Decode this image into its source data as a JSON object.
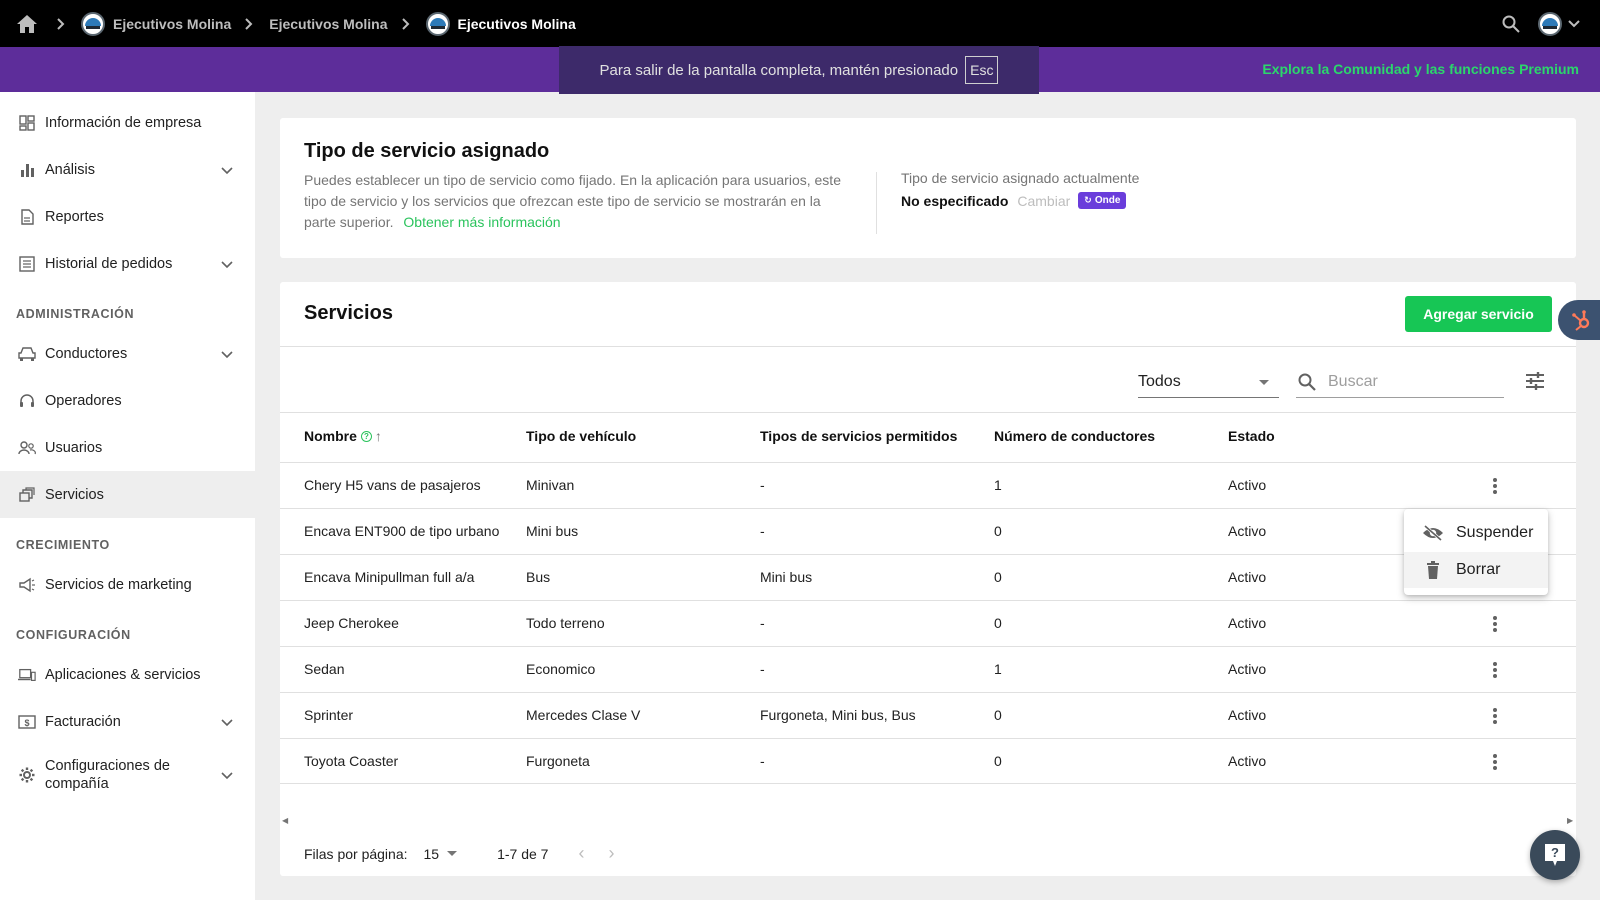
{
  "topbar": {
    "breadcrumbs": [
      {
        "label": "Ejecutivos Molina"
      },
      {
        "label": "Ejecutivos Molina"
      },
      {
        "label": "Ejecutivos Molina"
      }
    ]
  },
  "banner": {
    "fullscreen_message": "Para salir de la pantalla completa, mantén presionado",
    "esc_key": "Esc",
    "premium_link": "Explora la Comunidad y las funciones Premium"
  },
  "sidebar": {
    "items": [
      {
        "label": "Información de empresa",
        "icon": "dashboard-icon"
      },
      {
        "label": "Análisis",
        "icon": "bar-chart-icon",
        "expandable": true
      },
      {
        "label": "Reportes",
        "icon": "report-icon"
      },
      {
        "label": "Historial de pedidos",
        "icon": "list-icon",
        "expandable": true
      },
      {
        "label": "Conductores",
        "icon": "car-icon",
        "expandable": true
      },
      {
        "label": "Operadores",
        "icon": "headset-icon"
      },
      {
        "label": "Usuarios",
        "icon": "users-icon"
      },
      {
        "label": "Servicios",
        "icon": "services-icon",
        "active": true
      },
      {
        "label": "Servicios de marketing",
        "icon": "megaphone-icon"
      },
      {
        "label": "Aplicaciones & servicios",
        "icon": "devices-icon"
      },
      {
        "label": "Facturación",
        "icon": "billing-icon",
        "expandable": true
      },
      {
        "label": "Configuraciones de compañía",
        "icon": "gear-icon",
        "expandable": true
      }
    ],
    "sections": {
      "admin": "ADMINISTRACIÓN",
      "growth": "CRECIMIENTO",
      "config": "CONFIGURACIÓN"
    }
  },
  "assigned_card": {
    "title": "Tipo de servicio asignado",
    "description": "Puedes establecer un tipo de servicio como fijado. En la aplicación para usuarios, este tipo de servicio y los servicios que ofrezcan este tipo de servicio se mostrarán en la parte superior.",
    "learn_more": "Obtener más información",
    "current_label": "Tipo de servicio asignado actualmente",
    "current_value": "No especificado",
    "change_label": "Cambiar",
    "badge": "Onde"
  },
  "services_card": {
    "title": "Servicios",
    "add_button": "Agregar servicio",
    "filter_value": "Todos",
    "search_placeholder": "Buscar",
    "columns": [
      "Nombre",
      "Tipo de vehículo",
      "Tipos de servicios permitidos",
      "Número de conductores",
      "Estado"
    ],
    "rows": [
      {
        "name": "Chery H5 vans de pasajeros",
        "vehicle": "Minivan",
        "allowed": "-",
        "drivers": "1",
        "status": "Activo"
      },
      {
        "name": "Encava ENT900 de tipo urbano",
        "vehicle": "Mini bus",
        "allowed": "-",
        "drivers": "0",
        "status": "Activo"
      },
      {
        "name": "Encava Minipullman full a/a",
        "vehicle": "Bus",
        "allowed": "Mini bus",
        "drivers": "0",
        "status": "Activo"
      },
      {
        "name": "Jeep Cherokee",
        "vehicle": "Todo terreno",
        "allowed": "-",
        "drivers": "0",
        "status": "Activo"
      },
      {
        "name": "Sedan",
        "vehicle": "Economico",
        "allowed": "-",
        "drivers": "1",
        "status": "Activo"
      },
      {
        "name": "Sprinter",
        "vehicle": "Mercedes Clase V",
        "allowed": "Furgoneta, Mini bus, Bus",
        "drivers": "0",
        "status": "Activo"
      },
      {
        "name": "Toyota Coaster",
        "vehicle": "Furgoneta",
        "allowed": "-",
        "drivers": "0",
        "status": "Activo"
      }
    ],
    "rows_per_page_label": "Filas por página:",
    "rows_per_page": "15",
    "range": "1-7 de 7"
  },
  "context_menu": {
    "items": [
      {
        "label": "Suspender",
        "icon": "eye-off-icon"
      },
      {
        "label": "Borrar",
        "icon": "trash-icon"
      }
    ]
  },
  "colors": {
    "accent_green": "#17c655",
    "banner_purple": "#5d2d9a",
    "badge_purple": "#6a3ddb",
    "topbar": "#000000"
  }
}
